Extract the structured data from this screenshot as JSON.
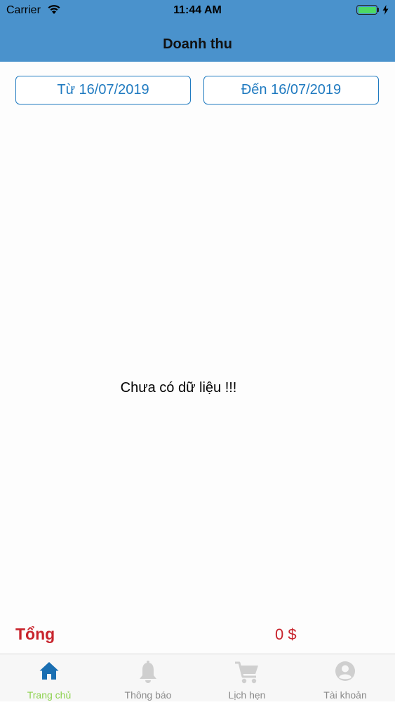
{
  "status_bar": {
    "carrier": "Carrier",
    "time": "11:44 AM"
  },
  "nav": {
    "title": "Doanh thu"
  },
  "date_range": {
    "from_label": "Từ 16/07/2019",
    "to_label": "Đến 16/07/2019"
  },
  "content": {
    "empty_message": "Chưa có dữ liệu !!!"
  },
  "summary": {
    "total_label": "Tổng",
    "total_value": "0 $"
  },
  "tabs": [
    {
      "label": "Trang chủ",
      "icon": "home-icon",
      "active": true
    },
    {
      "label": "Thông báo",
      "icon": "bell-icon",
      "active": false
    },
    {
      "label": "Lịch hẹn",
      "icon": "cart-icon",
      "active": false
    },
    {
      "label": "Tài khoản",
      "icon": "account-icon",
      "active": false
    }
  ],
  "colors": {
    "header": "#4a92cc",
    "accent": "#1f7ac0",
    "total": "#c8232c",
    "active_tab_label": "#8bd14b",
    "inactive_tab": "#cfcfcf"
  }
}
